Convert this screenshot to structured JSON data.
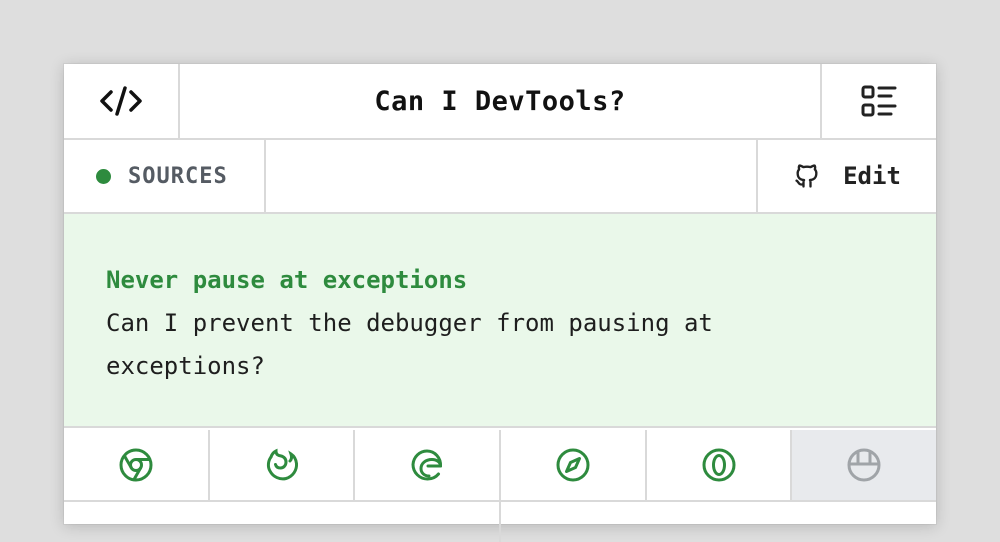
{
  "header": {
    "title": "Can I DevTools?",
    "left_icon": "code-icon",
    "right_icon": "list-icon"
  },
  "subbar": {
    "category": "SOURCES",
    "category_color": "#2e8b3e",
    "edit_label": "Edit",
    "edit_icon": "github-icon"
  },
  "tip": {
    "title": "Never pause at exceptions",
    "description_line1": "Can I prevent the debugger from pausing at",
    "description_line2": "exceptions?",
    "background": "#eaf8ea",
    "accent": "#2e8b3e"
  },
  "browsers": [
    {
      "icon": "chrome-icon",
      "supported": true
    },
    {
      "icon": "firefox-icon",
      "supported": true
    },
    {
      "icon": "edge-icon",
      "supported": true
    },
    {
      "icon": "safari-icon",
      "supported": true
    },
    {
      "icon": "opera-icon",
      "supported": true
    },
    {
      "icon": "polypane-icon",
      "supported": false
    }
  ]
}
